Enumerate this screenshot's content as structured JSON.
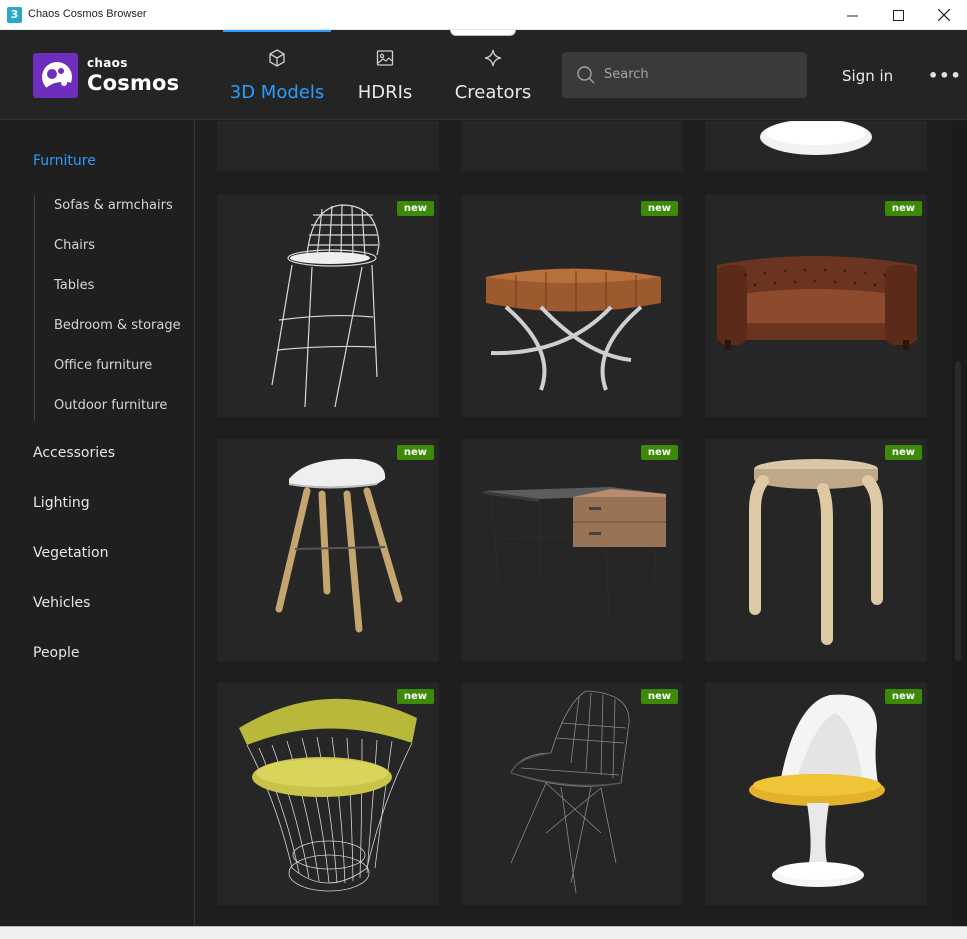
{
  "window": {
    "title": "Chaos Cosmos Browser",
    "app_icon": "3"
  },
  "header": {
    "logo": {
      "small": "chaos",
      "big": "Cosmos"
    },
    "tabs": [
      {
        "label": "3D Models",
        "icon": "cube-icon",
        "active": true
      },
      {
        "label": "HDRIs",
        "icon": "image-icon",
        "active": false
      },
      {
        "label": "Creators",
        "icon": "sparkle-icon",
        "active": false
      }
    ],
    "search": {
      "placeholder": "Search"
    },
    "sign_in": "Sign in",
    "more": "•••"
  },
  "sidebar": {
    "categories": [
      {
        "label": "Furniture",
        "active": true
      },
      {
        "label": "Accessories"
      },
      {
        "label": "Lighting"
      },
      {
        "label": "Vegetation"
      },
      {
        "label": "Vehicles"
      },
      {
        "label": "People"
      }
    ],
    "subcategories": [
      "Sofas & armchairs",
      "Chairs",
      "Tables",
      "Bedroom & storage",
      "Office furniture",
      "Outdoor furniture"
    ]
  },
  "grid": {
    "badge_label": "new",
    "items": [
      {
        "thumb": "wire-bar-stool",
        "badge": true
      },
      {
        "thumb": "leather-ottoman",
        "badge": true
      },
      {
        "thumb": "chesterfield-sofa",
        "badge": true
      },
      {
        "thumb": "white-bar-stool",
        "badge": true
      },
      {
        "thumb": "desk-with-drawers",
        "badge": true
      },
      {
        "thumb": "bentwood-stool",
        "badge": true
      },
      {
        "thumb": "wire-lounge-chair",
        "badge": true
      },
      {
        "thumb": "wire-side-chair",
        "badge": true
      },
      {
        "thumb": "tulip-chair",
        "badge": true
      }
    ]
  },
  "colors": {
    "accent": "#2d9cff",
    "badge": "#3c8a08",
    "logo": "#6f2dbd",
    "background": "#1f1f1f"
  }
}
